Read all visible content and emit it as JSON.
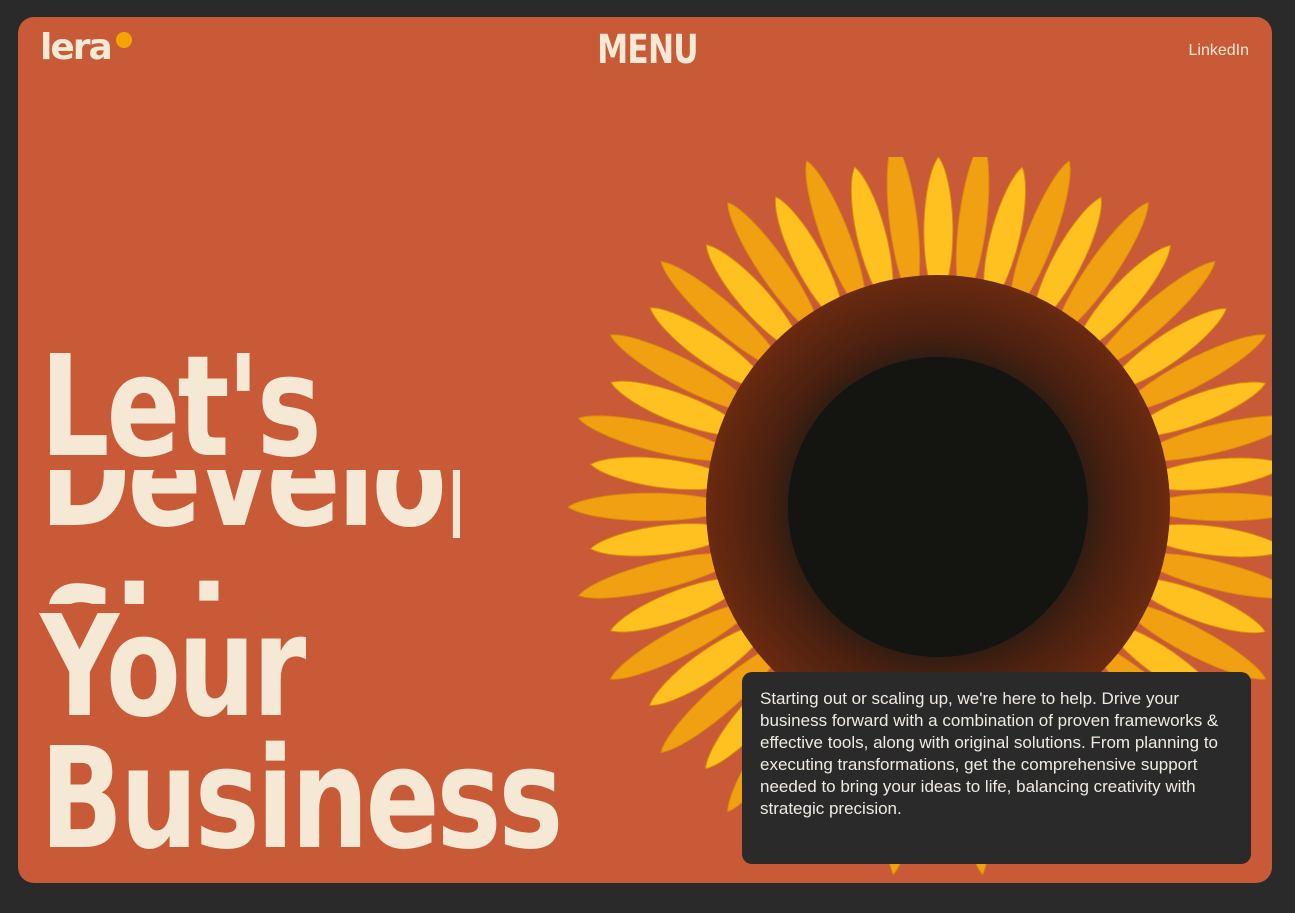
{
  "header": {
    "logo_text": "lera",
    "menu_label": "MENU",
    "linkedin_label": "LinkedIn"
  },
  "hero": {
    "line1": "Let's",
    "line2_partial": "Develop",
    "line3_partial": "Shine on",
    "line4": "Your",
    "line5": "Business"
  },
  "info": {
    "text": "Starting out or scaling up, we're here to help. Drive your business forward with a combination of proven frameworks & effective tools, along with original solutions. From planning to executing transformations, get the comprehensive support needed to bring your ideas to life, balancing creativity with strategic precision."
  },
  "colors": {
    "background": "#2a2a2a",
    "card": "#c85a38",
    "text_light": "#f5e9d6",
    "accent_dot": "#f5a300",
    "petal": "#f7b71a",
    "flower_center": "#1c1a14"
  },
  "image": {
    "subject": "sunflower"
  }
}
